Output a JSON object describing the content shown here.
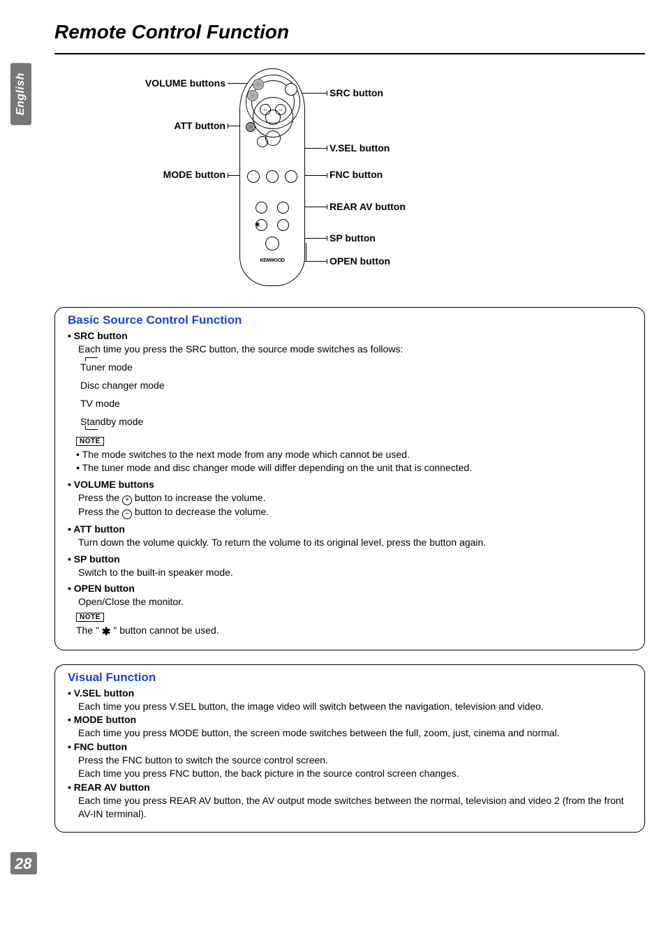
{
  "lang_tab": "English",
  "page_title": "Remote Control Function",
  "page_number": "28",
  "diagram": {
    "left": {
      "volume": "VOLUME buttons",
      "att": "ATT button",
      "mode": "MODE button"
    },
    "right": {
      "src": "SRC button",
      "vsel": "V.SEL button",
      "fnc": "FNC button",
      "rearav": "REAR AV button",
      "sp": "SP button",
      "open": "OPEN button"
    },
    "brand": "KENWOOD"
  },
  "section1": {
    "title": "Basic Source Control Function",
    "src": {
      "head": "SRC button",
      "body": "Each time you press the SRC button, the source mode switches as follows:",
      "modes": {
        "tuner": "Tuner mode",
        "disc": "Disc changer mode",
        "tv": "TV mode",
        "standby": "Standby mode"
      }
    },
    "note1_label": "NOTE",
    "note1_a": "The mode switches to the next mode from any mode which cannot be used.",
    "note1_b": "The tuner mode and disc changer mode will differ depending on the unit that is connected.",
    "volume": {
      "head": "VOLUME buttons",
      "line1a": "Press the ",
      "line1b": " button to increase the volume.",
      "line2a": "Press the ",
      "line2b": " button to decrease the volume."
    },
    "att": {
      "head": "ATT button",
      "body": "Turn down the volume quickly. To return the volume to its original level, press the button again."
    },
    "sp": {
      "head": "SP button",
      "body": "Switch to the built-in speaker mode."
    },
    "open": {
      "head": "OPEN button",
      "body": "Open/Close the monitor."
    },
    "note2_label": "NOTE",
    "note2_a": "The \" ",
    "note2_b": " \" button cannot be used."
  },
  "section2": {
    "title": "Visual Function",
    "vsel": {
      "head": "V.SEL button",
      "body": "Each time you press V.SEL button, the image video will switch between the navigation, television and video."
    },
    "mode": {
      "head": "MODE button",
      "body": "Each time you press MODE button, the screen mode switches between the full, zoom, just, cinema and normal."
    },
    "fnc": {
      "head": "FNC button",
      "body1": "Press the FNC button to switch the source control screen.",
      "body2": "Each time you press FNC button, the back picture in the source control screen changes."
    },
    "rearav": {
      "head": "REAR AV button",
      "body": "Each time you press REAR AV button, the AV output mode switches between the normal, television and video 2 (from the front AV-IN terminal)."
    }
  }
}
